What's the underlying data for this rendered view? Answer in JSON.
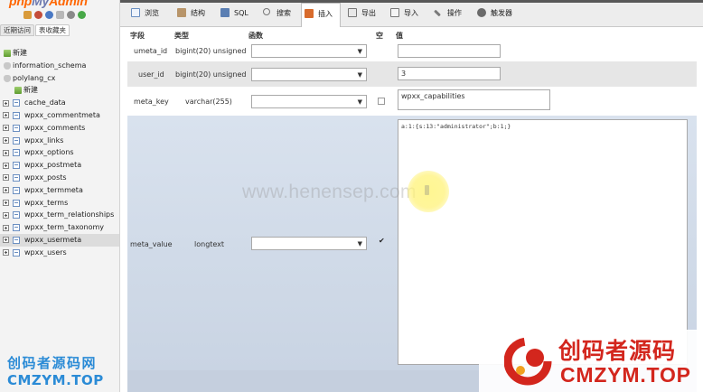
{
  "sidebar": {
    "logo": {
      "php": "php",
      "my": "My",
      "admin": "Admin"
    },
    "tabs": [
      {
        "label": "近期访问"
      },
      {
        "label": "表收藏夹"
      }
    ],
    "tree": [
      {
        "label": "新建",
        "kind": "new"
      },
      {
        "label": "information_schema",
        "kind": "db"
      },
      {
        "label": "polylang_cx",
        "kind": "db"
      },
      {
        "label": "新建",
        "kind": "new-child"
      },
      {
        "label": "cache_data",
        "kind": "table"
      },
      {
        "label": "wpxx_commentmeta",
        "kind": "table"
      },
      {
        "label": "wpxx_comments",
        "kind": "table"
      },
      {
        "label": "wpxx_links",
        "kind": "table"
      },
      {
        "label": "wpxx_options",
        "kind": "table"
      },
      {
        "label": "wpxx_postmeta",
        "kind": "table"
      },
      {
        "label": "wpxx_posts",
        "kind": "table"
      },
      {
        "label": "wpxx_termmeta",
        "kind": "table"
      },
      {
        "label": "wpxx_terms",
        "kind": "table"
      },
      {
        "label": "wpxx_term_relationships",
        "kind": "table"
      },
      {
        "label": "wpxx_term_taxonomy",
        "kind": "table"
      },
      {
        "label": "wpxx_usermeta",
        "kind": "table",
        "selected": true
      },
      {
        "label": "wpxx_users",
        "kind": "table"
      }
    ]
  },
  "menubar": {
    "tabs": [
      {
        "label": "浏览",
        "icon": "browse-icon"
      },
      {
        "label": "结构",
        "icon": "structure-icon"
      },
      {
        "label": "SQL",
        "icon": "sql-icon"
      },
      {
        "label": "搜索",
        "icon": "search-icon"
      },
      {
        "label": "插入",
        "icon": "insert-icon",
        "active": true
      },
      {
        "label": "导出",
        "icon": "export-icon"
      },
      {
        "label": "导入",
        "icon": "import-icon"
      },
      {
        "label": "操作",
        "icon": "operations-icon"
      },
      {
        "label": "触发器",
        "icon": "triggers-icon"
      }
    ]
  },
  "form": {
    "headers": {
      "field": "字段",
      "type": "类型",
      "function": "函数",
      "null": "空",
      "value": "值"
    },
    "rows": [
      {
        "field": "umeta_id",
        "type": "bigint(20) unsigned",
        "function": "",
        "null_checked": false,
        "value": ""
      },
      {
        "field": "user_id",
        "type": "bigint(20) unsigned",
        "function": "",
        "null_checked": false,
        "value": "3"
      },
      {
        "field": "meta_key",
        "type": "varchar(255)",
        "function": "",
        "null_checked": false,
        "value": "wpxx_capabilities"
      },
      {
        "field": "meta_value",
        "type": "longtext",
        "function": "",
        "null_checked": true,
        "value": "a:1:{s:13:\"administrator\";b:1;}"
      }
    ]
  },
  "watermarks": {
    "center": "www.henensep.com",
    "left_line1": "创码者源码网",
    "left_line2": "CMZYM.TOP",
    "right_line1": "创码者源码",
    "right_line2": "CMZYM.TOP"
  },
  "colors": {
    "logo_orange": "#ff6600",
    "logo_blue": "#6c78af",
    "watermark_red": "#d3261d",
    "watermark_blue": "#2b8bd6",
    "row_grad": "#c9d4e3"
  }
}
